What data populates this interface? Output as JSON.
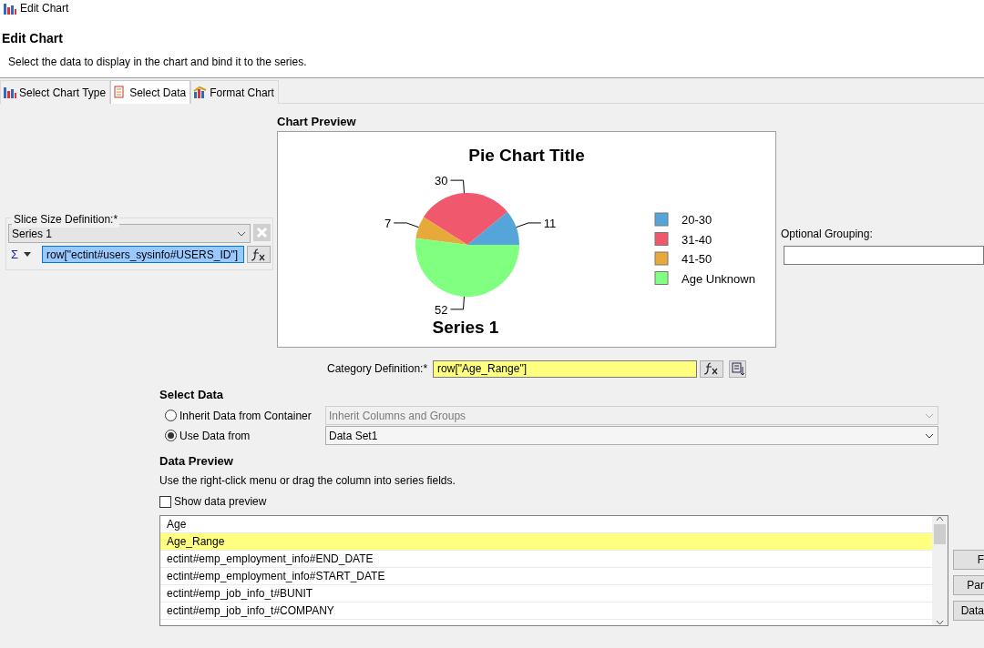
{
  "window": {
    "title": "Edit Chart"
  },
  "header": {
    "title": "Edit Chart",
    "description": "Select the data to display in the chart and bind it to the series."
  },
  "tabs": [
    {
      "label": "Select Chart Type",
      "selected": false
    },
    {
      "label": "Select Data",
      "selected": true
    },
    {
      "label": "Format Chart",
      "selected": false
    }
  ],
  "slice_size": {
    "label": "Slice Size Definition:*",
    "series": "Series 1",
    "aggregate": "Σ",
    "expression": "row[\"ectint#users_sysinfo#USERS_ID\"]",
    "expression_selected": true
  },
  "chart_preview": {
    "label": "Chart Preview",
    "chart_data": {
      "type": "pie",
      "title": "Pie Chart Title",
      "categories": [
        "20-30",
        "31-40",
        "41-50",
        "Age Unknown"
      ],
      "series": [
        {
          "name": "Series 1",
          "colors": [
            "#55a5db",
            "#f0596d",
            "#e8a93b",
            "#80ff80"
          ],
          "values": [
            11,
            30,
            7,
            52
          ]
        }
      ],
      "data_labels": true,
      "legend": true
    }
  },
  "optional_grouping": {
    "label": "Optional Grouping:"
  },
  "category": {
    "label": "Category Definition:*",
    "value": "row[\"Age_Range\"]",
    "highlighted": true
  },
  "select_data": {
    "title": "Select Data",
    "options": [
      {
        "label": "Inherit Data from Container",
        "selected": false,
        "dropdown": "Inherit Columns and Groups",
        "disabled": true
      },
      {
        "label": "Use Data from",
        "selected": true,
        "dropdown": "Data Set1",
        "disabled": false
      }
    ]
  },
  "data_preview": {
    "title": "Data Preview",
    "hint": "Use the right-click menu or drag the column into series fields.",
    "show_preview": {
      "label": "Show data preview",
      "checked": false
    },
    "columns": [
      {
        "label": "Age",
        "selected": false
      },
      {
        "label": "Age_Range",
        "selected": true
      },
      {
        "label": "ectint#emp_employment_info#END_DATE",
        "selected": false
      },
      {
        "label": "ectint#emp_employment_info#START_DATE",
        "selected": false
      },
      {
        "label": "ectint#emp_job_info_t#BUNIT",
        "selected": false
      },
      {
        "label": "ectint#emp_job_info_t#COMPANY",
        "selected": false
      }
    ],
    "buttons": [
      "F",
      "Par",
      "Data"
    ]
  }
}
